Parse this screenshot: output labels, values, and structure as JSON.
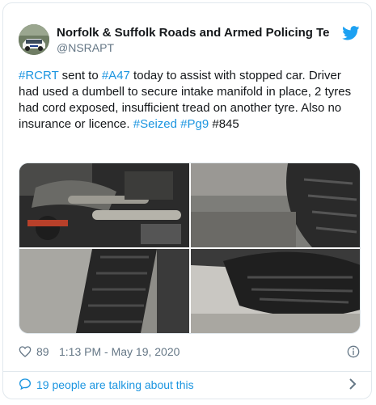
{
  "account": {
    "display_name": "Norfolk & Suffolk Roads and Armed Policing Te",
    "handle": "@NSRAPT"
  },
  "tweet": {
    "parts": [
      {
        "text": "#RCRT",
        "link": true
      },
      {
        "text": " sent to ",
        "link": false
      },
      {
        "text": "#A47",
        "link": true
      },
      {
        "text": " today to assist with stopped car. Driver had used a dumbell to secure intake manifold in place, 2 tyres had cord exposed, insufficient tread on another tyre. Also no insurance or licence. ",
        "link": false
      },
      {
        "text": "#Seized",
        "link": true
      },
      {
        "text": " ",
        "link": false
      },
      {
        "text": "#Pg9",
        "link": true
      },
      {
        "text": " #845",
        "link": false
      }
    ]
  },
  "media": {
    "images": [
      "engine bay",
      "worn tyre",
      "tyre sidewall",
      "tyre on gravel"
    ]
  },
  "meta": {
    "likes": "89",
    "timestamp": "1:13 PM - May 19, 2020"
  },
  "footer": {
    "talking": "19 people are talking about this"
  },
  "colors": {
    "link": "#1b95e0",
    "secondary_text": "#657786",
    "border": "#e1e8ed"
  },
  "icons": [
    "twitter-bird-icon",
    "heart-icon",
    "info-icon",
    "speech-bubble-icon",
    "chevron-right-icon"
  ]
}
